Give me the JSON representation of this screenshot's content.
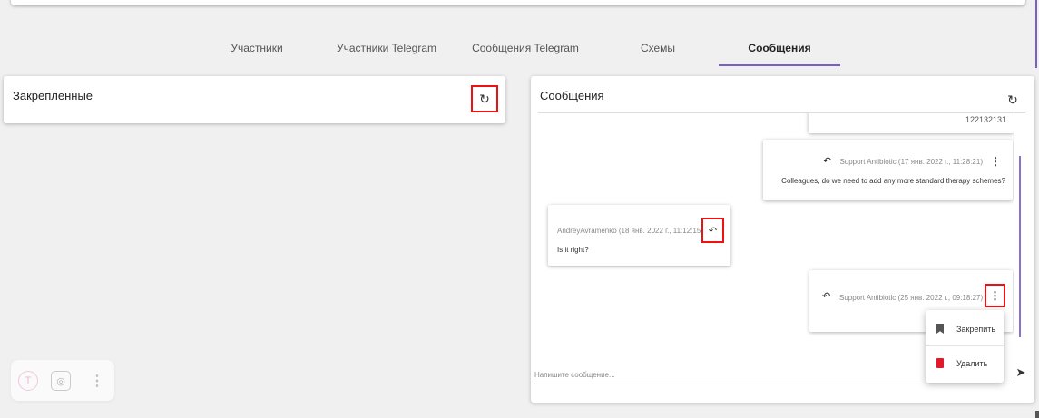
{
  "tabs": [
    {
      "label": "Участники"
    },
    {
      "label": "Участники Telegram"
    },
    {
      "label": "Сообщения Telegram"
    },
    {
      "label": "Схемы"
    },
    {
      "label": "Сообщения",
      "active": true
    }
  ],
  "pinned": {
    "title": "Закрепленные",
    "refresh_icon": "refresh-icon"
  },
  "messages": {
    "title": "Сообщения",
    "refresh_icon": "refresh-icon",
    "items": [
      {
        "text": "122132131"
      },
      {
        "meta": "Support Antibiotic (17 янв. 2022 г., 11:28:21)",
        "text": "Colleagues, do we need to add any more standard therapy schemes?"
      },
      {
        "meta": "AndreyAvramenko (18 янв. 2022 г., 11:12:15)",
        "text": "Is it right?"
      },
      {
        "meta": "Support Antibiotic (25 янв. 2022 г., 09:18:27)"
      }
    ],
    "input_placeholder": "Напишите сообщение...",
    "send_icon": "send-icon"
  },
  "context_menu": {
    "pin_label": "Закрепить",
    "delete_label": "Удалить"
  },
  "colors": {
    "accent": "#7b5fc7",
    "highlight": "#e11111",
    "delete": "#e01a2b"
  }
}
